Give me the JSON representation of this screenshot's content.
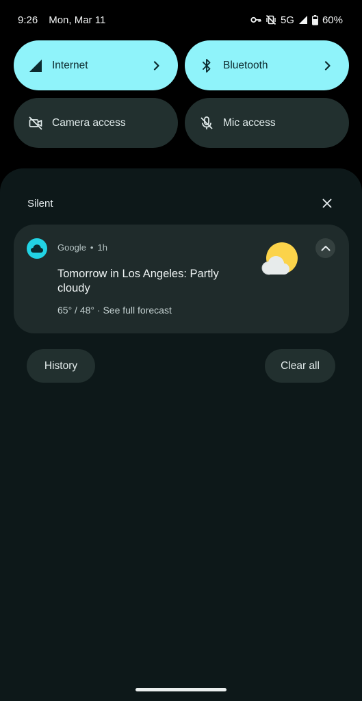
{
  "status_bar": {
    "time": "9:26",
    "date": "Mon, Mar 11",
    "network": "5G",
    "battery": "60%",
    "icons": [
      "vpn-key-icon",
      "vibrate-off-icon",
      "signal-icon",
      "battery-icon"
    ]
  },
  "quick_settings": {
    "tiles": [
      {
        "label": "Internet",
        "icon": "signal-icon",
        "state": "on",
        "has_chevron": true
      },
      {
        "label": "Bluetooth",
        "icon": "bluetooth-icon",
        "state": "on",
        "has_chevron": true
      },
      {
        "label": "Camera access",
        "icon": "camera-off-icon",
        "state": "off",
        "has_chevron": false
      },
      {
        "label": "Mic access",
        "icon": "mic-off-icon",
        "state": "off",
        "has_chevron": false
      }
    ]
  },
  "notifications": {
    "section_title": "Silent",
    "items": [
      {
        "app": "Google",
        "separator": "•",
        "time": "1h",
        "title": "Tomorrow in Los Angeles: Partly cloudy",
        "body": "65° / 48° · See full forecast",
        "icon": "cloud-icon",
        "thumbnail": "partly-cloudy-icon"
      }
    ],
    "history_label": "History",
    "clear_label": "Clear all"
  },
  "colors": {
    "tile_on": "#8ff3fa",
    "tile_off": "#22302f",
    "shade_bg": "#0d1819",
    "card_bg": "#1f2b2b",
    "app_icon": "#22d3e4",
    "sun": "#fbd34a"
  }
}
